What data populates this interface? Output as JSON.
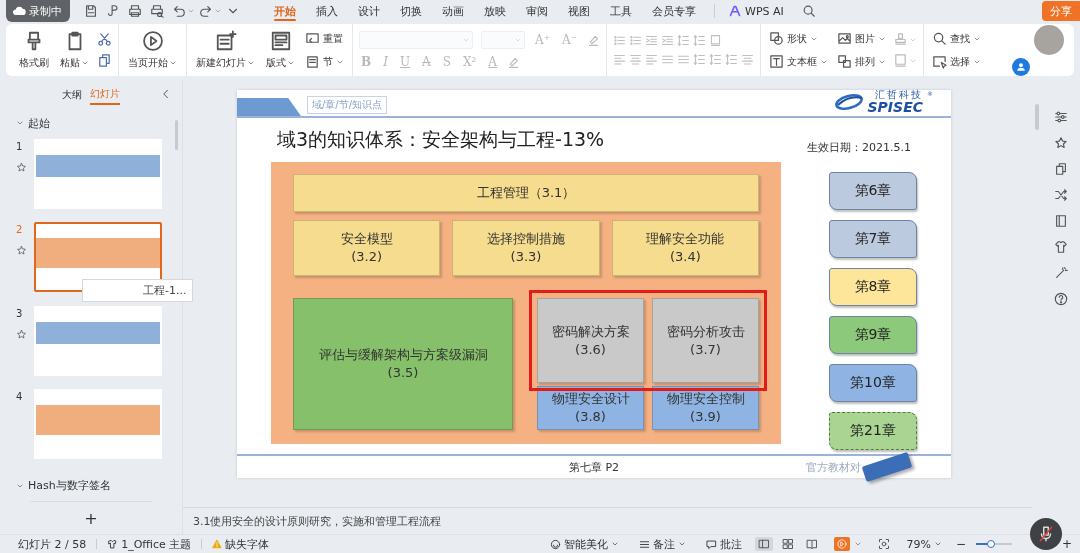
{
  "title_bar": {
    "recording": "录制中",
    "tabs": [
      {
        "label": "开始",
        "selected": true
      },
      {
        "label": "插入",
        "selected": false
      },
      {
        "label": "设计",
        "selected": false
      },
      {
        "label": "切换",
        "selected": false
      },
      {
        "label": "动画",
        "selected": false
      },
      {
        "label": "放映",
        "selected": false
      },
      {
        "label": "审阅",
        "selected": false
      },
      {
        "label": "视图",
        "selected": false
      },
      {
        "label": "工具",
        "selected": false
      },
      {
        "label": "会员专享",
        "selected": false
      }
    ],
    "ai_label": "WPS AI",
    "share_button": "分享"
  },
  "ribbon": {
    "groups": [
      {
        "kind": "tools",
        "columns": [
          [
            {
              "kind": "large",
              "label": "格式刷",
              "dropdown": false
            }
          ],
          [
            {
              "kind": "large",
              "label": "粘贴",
              "dropdown": true
            }
          ],
          [
            {
              "kind": "icon",
              "dropdown": false,
              "disabled": false
            },
            {
              "kind": "icon",
              "dropdown": false,
              "disabled": false
            }
          ]
        ]
      },
      {
        "kind": "tools",
        "columns": [
          [
            {
              "kind": "large",
              "label": "当页开始",
              "dropdown": true
            }
          ]
        ]
      },
      {
        "kind": "tools",
        "columns": [
          [
            {
              "kind": "large",
              "label": "新建幻灯片",
              "dropdown": true
            }
          ],
          [
            {
              "kind": "large",
              "label": "版式",
              "dropdown": true
            }
          ],
          [
            {
              "kind": "small",
              "label": "重置",
              "dropdown": false
            },
            {
              "kind": "small",
              "label": "节",
              "dropdown": true
            }
          ]
        ]
      },
      {
        "kind": "font",
        "disabled": true,
        "size_glyphs": [
          "A⁺",
          "A⁻"
        ],
        "glyphs": [
          "B",
          "I",
          "U",
          "A",
          "S",
          "X²",
          "A"
        ]
      },
      {
        "kind": "paragraph",
        "disabled": true
      },
      {
        "kind": "tools",
        "columns": [
          [
            {
              "kind": "small",
              "label": "形状",
              "dropdown": true
            },
            {
              "kind": "small",
              "label": "文本框",
              "dropdown": true
            }
          ],
          [
            {
              "kind": "small",
              "label": "图片",
              "dropdown": true
            },
            {
              "kind": "small",
              "label": "排列",
              "dropdown": true
            }
          ],
          [
            {
              "kind": "icon",
              "dropdown": true,
              "disabled": true
            },
            {
              "kind": "icon",
              "dropdown": true,
              "disabled": true
            }
          ]
        ]
      },
      {
        "kind": "tools",
        "columns": [
          [
            {
              "kind": "small",
              "label": "查找",
              "dropdown": true
            },
            {
              "kind": "small",
              "label": "选择",
              "dropdown": true
            }
          ]
        ]
      }
    ]
  },
  "slide_panel": {
    "tabs": [
      {
        "label": "大纲",
        "selected": false
      },
      {
        "label": "幻灯片",
        "selected": true
      }
    ],
    "sections": [
      {
        "title": "起始",
        "slides": [
          {
            "number": "1",
            "animated": true,
            "selected": false
          },
          {
            "number": "2",
            "animated": true,
            "selected": true
          },
          {
            "number": "3",
            "animated": true,
            "selected": false
          },
          {
            "number": "4",
            "animated": false,
            "selected": false
          }
        ]
      },
      {
        "title": "Hash与数字签名"
      }
    ],
    "tooltip": "工程-1...",
    "add_button": "+"
  },
  "slide": {
    "breadcrumb": "域/章/节/知识点",
    "logo": {
      "name_cn": "汇哲科技",
      "registered": "®",
      "name_en": "SPISEC"
    },
    "title": "域3的知识体系：安全架构与工程-13%",
    "date": "生效日期：2021.5.1",
    "knowledge_map": {
      "top": {
        "label": "工程管理（3.1）",
        "color": "#f6dc8e"
      },
      "middle": [
        {
          "title": "安全模型",
          "code": "(3.2)",
          "color": "#f6dc8e"
        },
        {
          "title": "选择控制措施",
          "code": "(3.3)",
          "color": "#f6dc8e"
        },
        {
          "title": "理解安全功能",
          "code": "(3.4)",
          "color": "#f6dc8e"
        }
      ],
      "large": {
        "title": "评估与缓解架构与方案级漏洞",
        "code": "(3.5)",
        "color": "#86c06a"
      },
      "highlighted_group": {
        "highlighted": true,
        "items": [
          {
            "title": "密码解决方案",
            "code": "(3.6)",
            "color": "#c9c9c9"
          },
          {
            "title": "密码分析攻击",
            "code": "(3.7)",
            "color": "#c9c9c9"
          }
        ]
      },
      "bottom": [
        {
          "title": "物理安全设计",
          "code": "(3.8)",
          "color": "#8fb4e3"
        },
        {
          "title": "物理安全控制",
          "code": "(3.9)",
          "color": "#8fb4e3"
        }
      ]
    },
    "chapters": [
      {
        "label": "第6章",
        "color": "#bccadf",
        "dashed": false
      },
      {
        "label": "第7章",
        "color": "#bccadf",
        "dashed": false
      },
      {
        "label": "第8章",
        "color": "#fde59a",
        "dashed": false
      },
      {
        "label": "第9章",
        "color": "#8dc97a",
        "dashed": false
      },
      {
        "label": "第10章",
        "color": "#8fb4e3",
        "dashed": false
      },
      {
        "label": "第21章",
        "color": "#a9d491",
        "dashed": true
      }
    ],
    "footer": "第七章 P2",
    "reference": "官方教材对"
  },
  "notes": "3.1使用安全的设计原则研究，实施和管理工程流程",
  "status_bar": {
    "slide_counter": "幻灯片 2 / 58",
    "theme": "1_Office 主题",
    "missing_fonts": "缺失字体",
    "beautify": "智能美化",
    "notes_button": "备注",
    "comments_button": "批注",
    "views": [
      {
        "selected": true
      },
      {
        "selected": false
      },
      {
        "selected": false
      }
    ],
    "zoom": "79%",
    "zoom_out": "−",
    "zoom_slider": {
      "level": 0.42
    },
    "zoom_in": "+"
  }
}
